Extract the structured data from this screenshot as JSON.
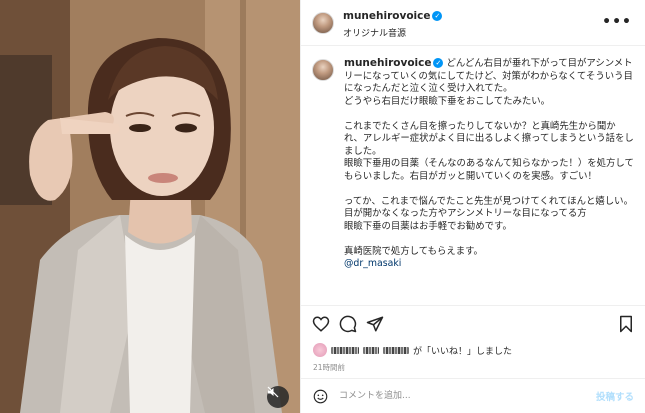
{
  "post": {
    "username": "munehirovoice",
    "verified_mark": "✓",
    "audio": "オリジナル音源",
    "more_icon": "more-horizontal-icon"
  },
  "caption": {
    "username": "munehirovoice",
    "verified_mark": "✓",
    "lines": [
      "どんどん右目が垂れ下がって目がアシンメトリーになっていくの気にしてたけど、対策がわからなくてそういう目になったんだと泣く泣く受け入れてた。",
      "どうやら右目だけ眼瞼下垂をおこしてたみたい。",
      "",
      "これまでたくさん目を擦ったりしてないか？と真崎先生から聞かれ、アレルギー症状がよく目に出るしよく擦ってしまうという話をしました。",
      "眼瞼下垂用の目薬（そんなのあるなんて知らなかった！）を処方してもらいました。右目がガッと開いていくのを実感。すごい！",
      "",
      "ってか、これまで悩んでたこと先生が見つけてくれてほんと嬉しい。",
      "目が開かなくなった方やアシンメトリーな目になってる方",
      "眼瞼下垂の目薬はお手軽でお勧めです。",
      "",
      "真崎医院で処方してもらえます。"
    ],
    "mention": "@dr_masaki"
  },
  "actions": {
    "like_icon": "heart-icon",
    "comment_icon": "comment-icon",
    "share_icon": "send-icon",
    "save_icon": "bookmark-icon"
  },
  "likes": {
    "suffix": "が「いいね！」しました"
  },
  "time_ago": "21時間前",
  "comment": {
    "placeholder": "コメントを追加...",
    "post_label": "投稿する",
    "emoji_icon": "smiley-icon"
  },
  "media": {
    "mute_icon": "speaker-muted-icon"
  },
  "colors": {
    "verified": "#0095f6",
    "link": "#00376b",
    "post_button_disabled": "#b2dffc",
    "secondary_text": "#8e8e8e"
  }
}
